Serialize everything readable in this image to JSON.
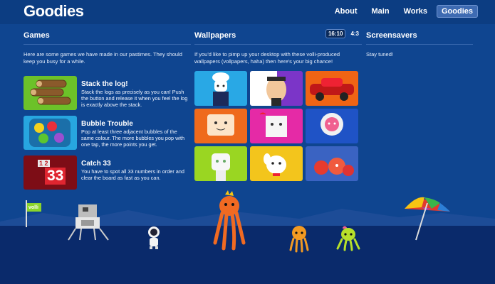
{
  "header": {
    "title": "Goodies",
    "nav": [
      {
        "label": "About"
      },
      {
        "label": "Main"
      },
      {
        "label": "Works"
      },
      {
        "label": "Goodies",
        "active": true
      }
    ]
  },
  "games": {
    "title": "Games",
    "intro": "Here are some games we have made in our pastimes. They should keep you busy for a while.",
    "items": [
      {
        "name": "Stack the log!",
        "desc": "Stack the logs as precisely as you can! Push the button and release it when you feel the log is exactly above the stack."
      },
      {
        "name": "Bubble Trouble",
        "desc": "Pop at least three adjacent bubbles of the same colour. The more bubbles you pop with one tap, the more points you get."
      },
      {
        "name": "Catch 33",
        "desc": "You have to spot all 33 numbers in order and clear the board as fast as you can.",
        "thumb_small": "1 2",
        "thumb_big": "33"
      }
    ]
  },
  "wallpapers": {
    "title": "Wallpapers",
    "ratios": [
      "16:10",
      "4:3"
    ],
    "selected_ratio": "16:10",
    "intro": "If you'd like to pimp up your desktop with these volli-produced wallpapers (vollpapers, haha) then here's your big chance!"
  },
  "screensavers": {
    "title": "Screensavers",
    "intro": "Stay tuned!"
  },
  "scene": {
    "flag_label": "volli"
  },
  "colors": {
    "background": "#0f4590",
    "header": "#0c3d82",
    "ground": "#0a2a6b"
  }
}
